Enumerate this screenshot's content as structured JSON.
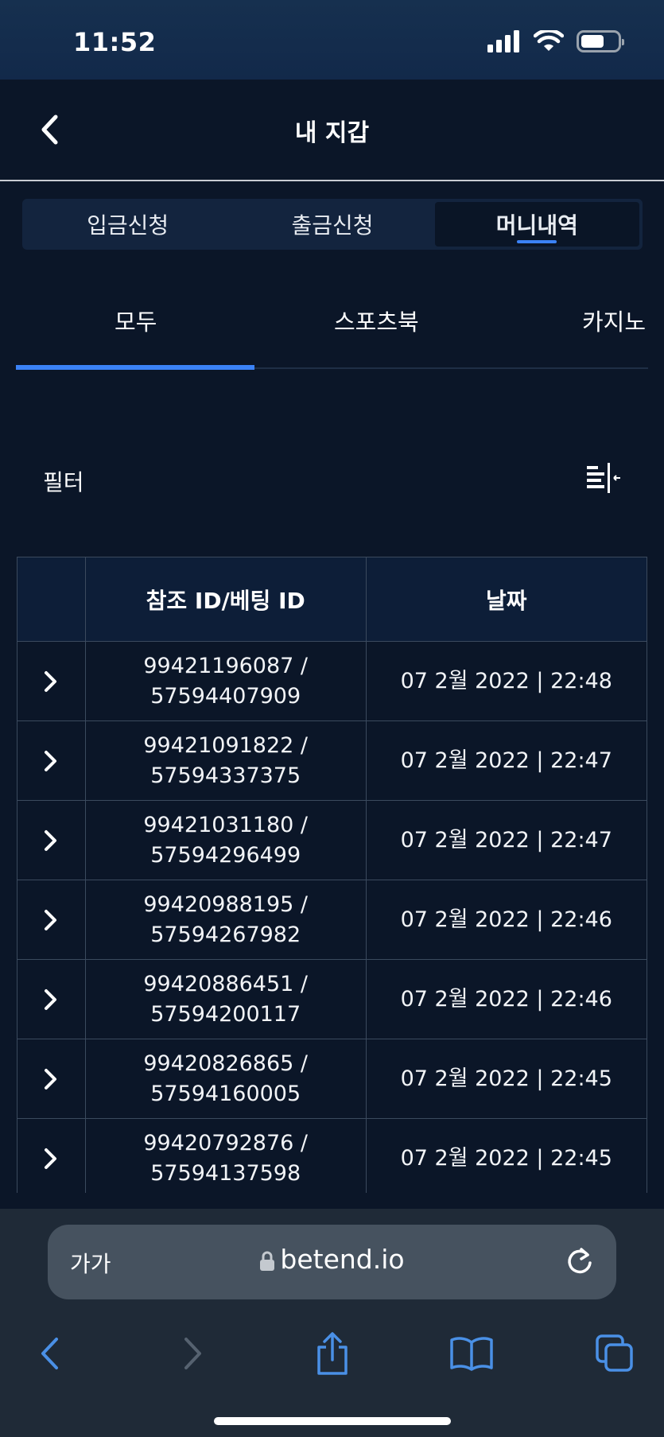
{
  "status_bar": {
    "time": "11:52"
  },
  "header": {
    "title": "내 지갑"
  },
  "wallet_tabs": [
    {
      "label": "입금신청",
      "active": false
    },
    {
      "label": "출금신청",
      "active": false
    },
    {
      "label": "머니내역",
      "active": true
    }
  ],
  "category_tabs": [
    {
      "label": "모두",
      "active": true
    },
    {
      "label": "스포츠북",
      "active": false
    },
    {
      "label": "카지노",
      "active": false
    }
  ],
  "filter": {
    "label": "필터"
  },
  "table": {
    "headers": [
      "",
      "참조 ID/베팅 ID",
      "날짜"
    ],
    "rows": [
      {
        "ref": "99421196087 /",
        "bet": "57594407909",
        "date": "07 2월 2022 | 22:48"
      },
      {
        "ref": "99421091822 /",
        "bet": "57594337375",
        "date": "07 2월 2022 | 22:47"
      },
      {
        "ref": "99421031180 /",
        "bet": "57594296499",
        "date": "07 2월 2022 | 22:47"
      },
      {
        "ref": "99420988195 /",
        "bet": "57594267982",
        "date": "07 2월 2022 | 22:46"
      },
      {
        "ref": "99420886451 /",
        "bet": "57594200117",
        "date": "07 2월 2022 | 22:46"
      },
      {
        "ref": "99420826865 /",
        "bet": "57594160005",
        "date": "07 2월 2022 | 22:45"
      },
      {
        "ref": "99420792876 /",
        "bet": "57594137598",
        "date": "07 2월 2022 | 22:45"
      }
    ]
  },
  "browser": {
    "text_size_label": "가가",
    "url": "betend.io"
  },
  "colors": {
    "accent": "#3b82f6",
    "background": "#0b1628",
    "table_header": "#0d1e38"
  }
}
